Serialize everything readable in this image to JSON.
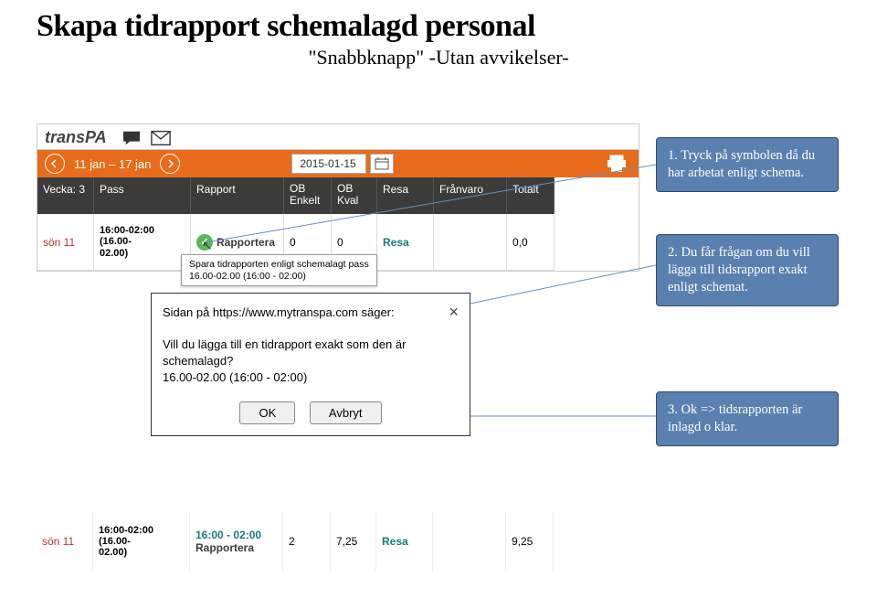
{
  "header": {
    "title": "Skapa tidrapport schemalagd personal",
    "subtitle": "\"Snabbknapp\" -Utan avvikelser-"
  },
  "app": {
    "logo_text": "transPA",
    "date_range": "11 jan – 17 jan",
    "date_input": "2015-01-15",
    "columns": {
      "c0": "Vecka: 3",
      "c1": "Pass",
      "c2": "Rapport",
      "c3a": "OB",
      "c3b": "Enkelt",
      "c4a": "OB",
      "c4b": "Kval",
      "c5": "Resa",
      "c6": "Frånvaro",
      "c7": "Totalt"
    },
    "row1": {
      "day": "sön 11",
      "pass_l1": "16:00-02:00",
      "pass_l2": "(16.00-",
      "pass_l3": "02.00)",
      "report": "Rapportera",
      "ob_en": "0",
      "ob_kv": "0",
      "resa": "Resa",
      "total": "0,0"
    }
  },
  "tooltip": {
    "l1": "Spara tidrapporten enligt schemalagt pass",
    "l2": "16.00-02.00 (16:00 - 02:00)"
  },
  "dialog": {
    "head": "Sidan på https://www.mytranspa.com säger:",
    "body_l1": "Vill du lägga till en tidrapport exakt som den är schemalagd?",
    "body_l2": "16.00-02.00 (16:00 - 02:00)",
    "ok": "OK",
    "cancel": "Avbryt"
  },
  "result_row": {
    "day": "sön 11",
    "pass_l1": "16:00-02:00",
    "pass_l2": "(16.00-",
    "pass_l3": "02.00)",
    "rep_l1": "16:00 - 02:00",
    "rep_l2": "Rapportera",
    "ob_en": "2",
    "ob_kv": "7,25",
    "resa": "Resa",
    "total": "9,25"
  },
  "notes": {
    "n1": "1. Tryck på symbolen då du har arbetat enligt schema.",
    "n2": "2. Du får frågan om du vill lägga till tidsrapport exakt enligt schemat.",
    "n3": "3. Ok => tidsrapporten är inlagd o klar."
  }
}
